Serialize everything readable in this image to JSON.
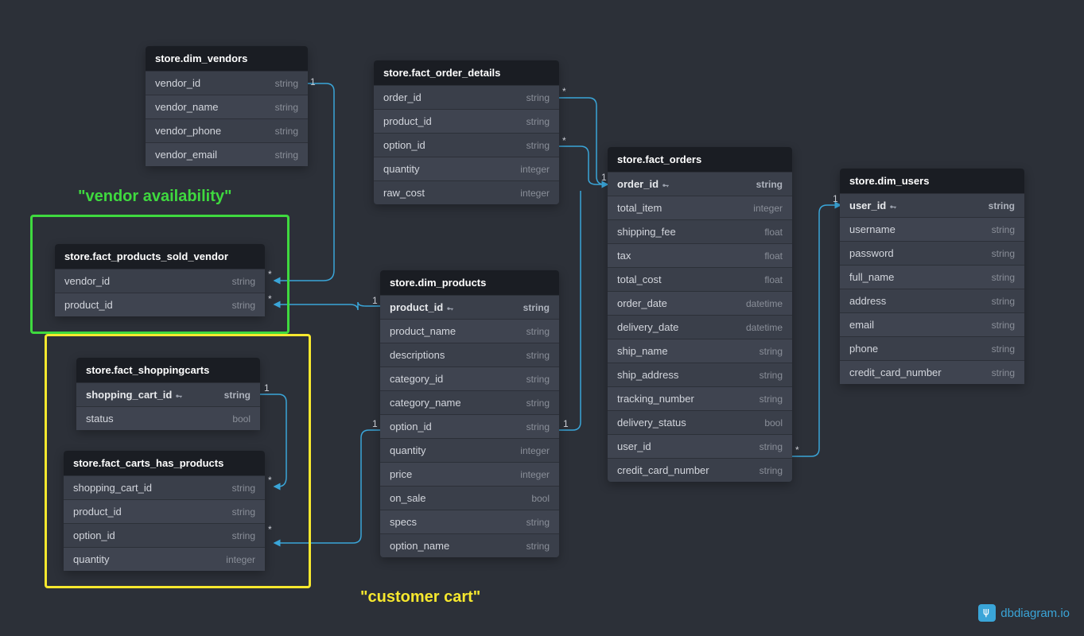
{
  "annotations": {
    "vendor_avail": "\"vendor availability\"",
    "customer_cart": "\"customer cart\""
  },
  "logo_text": "dbdiagram.io",
  "tables": {
    "dim_vendors": {
      "title": "store.dim_vendors",
      "rows": [
        {
          "name": "vendor_id",
          "type": "string",
          "pk": false
        },
        {
          "name": "vendor_name",
          "type": "string",
          "pk": false
        },
        {
          "name": "vendor_phone",
          "type": "string",
          "pk": false
        },
        {
          "name": "vendor_email",
          "type": "string",
          "pk": false
        }
      ]
    },
    "fact_order_details": {
      "title": "store.fact_order_details",
      "rows": [
        {
          "name": "order_id",
          "type": "string",
          "pk": false
        },
        {
          "name": "product_id",
          "type": "string",
          "pk": false
        },
        {
          "name": "option_id",
          "type": "string",
          "pk": false
        },
        {
          "name": "quantity",
          "type": "integer",
          "pk": false
        },
        {
          "name": "raw_cost",
          "type": "integer",
          "pk": false
        }
      ]
    },
    "fact_orders": {
      "title": "store.fact_orders",
      "rows": [
        {
          "name": "order_id",
          "type": "string",
          "pk": true
        },
        {
          "name": "total_item",
          "type": "integer",
          "pk": false
        },
        {
          "name": "shipping_fee",
          "type": "float",
          "pk": false
        },
        {
          "name": "tax",
          "type": "float",
          "pk": false
        },
        {
          "name": "total_cost",
          "type": "float",
          "pk": false
        },
        {
          "name": "order_date",
          "type": "datetime",
          "pk": false
        },
        {
          "name": "delivery_date",
          "type": "datetime",
          "pk": false
        },
        {
          "name": "ship_name",
          "type": "string",
          "pk": false
        },
        {
          "name": "ship_address",
          "type": "string",
          "pk": false
        },
        {
          "name": "tracking_number",
          "type": "string",
          "pk": false
        },
        {
          "name": "delivery_status",
          "type": "bool",
          "pk": false
        },
        {
          "name": "user_id",
          "type": "string",
          "pk": false
        },
        {
          "name": "credit_card_number",
          "type": "string",
          "pk": false
        }
      ]
    },
    "dim_users": {
      "title": "store.dim_users",
      "rows": [
        {
          "name": "user_id",
          "type": "string",
          "pk": true
        },
        {
          "name": "username",
          "type": "string",
          "pk": false
        },
        {
          "name": "password",
          "type": "string",
          "pk": false
        },
        {
          "name": "full_name",
          "type": "string",
          "pk": false
        },
        {
          "name": "address",
          "type": "string",
          "pk": false
        },
        {
          "name": "email",
          "type": "string",
          "pk": false
        },
        {
          "name": "phone",
          "type": "string",
          "pk": false
        },
        {
          "name": "credit_card_number",
          "type": "string",
          "pk": false
        }
      ]
    },
    "fact_products_sold_vendor": {
      "title": "store.fact_products_sold_vendor",
      "rows": [
        {
          "name": "vendor_id",
          "type": "string",
          "pk": false
        },
        {
          "name": "product_id",
          "type": "string",
          "pk": false
        }
      ]
    },
    "dim_products": {
      "title": "store.dim_products",
      "rows": [
        {
          "name": "product_id",
          "type": "string",
          "pk": true
        },
        {
          "name": "product_name",
          "type": "string",
          "pk": false
        },
        {
          "name": "descriptions",
          "type": "string",
          "pk": false
        },
        {
          "name": "category_id",
          "type": "string",
          "pk": false
        },
        {
          "name": "category_name",
          "type": "string",
          "pk": false
        },
        {
          "name": "option_id",
          "type": "string",
          "pk": false
        },
        {
          "name": "quantity",
          "type": "integer",
          "pk": false
        },
        {
          "name": "price",
          "type": "integer",
          "pk": false
        },
        {
          "name": "on_sale",
          "type": "bool",
          "pk": false
        },
        {
          "name": "specs",
          "type": "string",
          "pk": false
        },
        {
          "name": "option_name",
          "type": "string",
          "pk": false
        }
      ]
    },
    "fact_shoppingcarts": {
      "title": "store.fact_shoppingcarts",
      "rows": [
        {
          "name": "shopping_cart_id",
          "type": "string",
          "pk": true
        },
        {
          "name": "status",
          "type": "bool",
          "pk": false
        }
      ]
    },
    "fact_carts_has_products": {
      "title": "store.fact_carts_has_products",
      "rows": [
        {
          "name": "shopping_cart_id",
          "type": "string",
          "pk": false
        },
        {
          "name": "product_id",
          "type": "string",
          "pk": false
        },
        {
          "name": "option_id",
          "type": "string",
          "pk": false
        },
        {
          "name": "quantity",
          "type": "integer",
          "pk": false
        }
      ]
    }
  }
}
